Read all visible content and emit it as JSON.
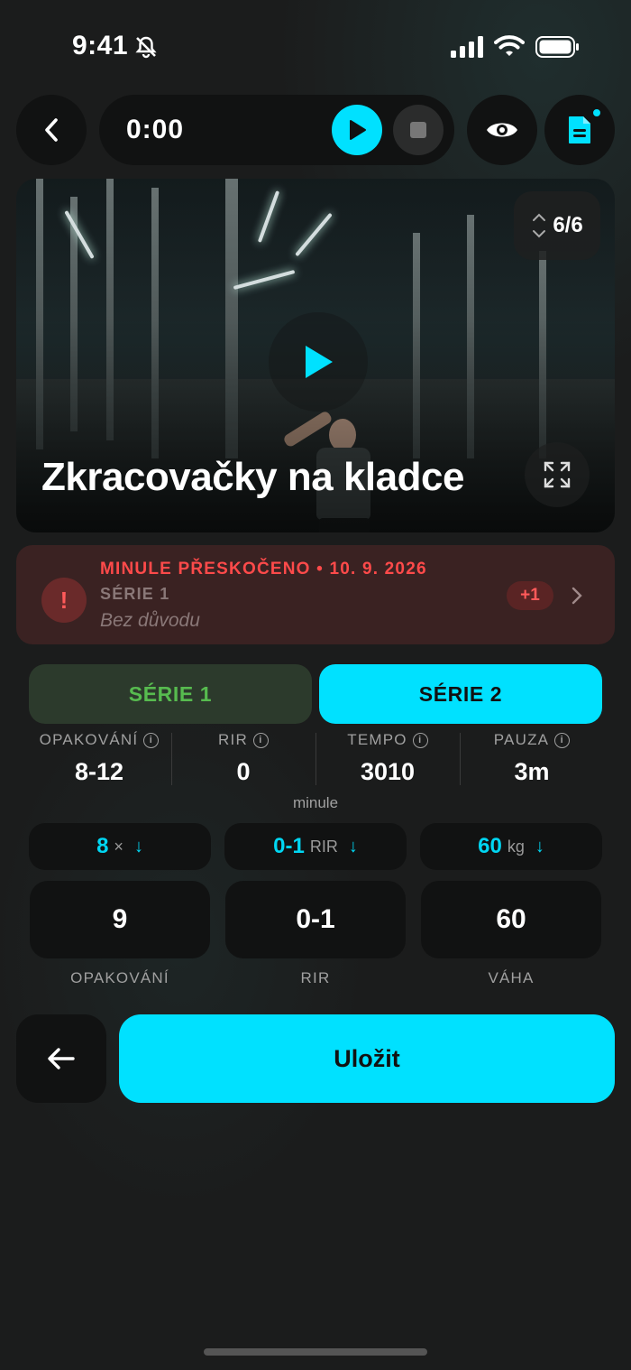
{
  "status_bar": {
    "time": "9:41",
    "icons": [
      "bell-slash-icon",
      "cellular-signal-icon",
      "wifi-icon",
      "battery-icon"
    ]
  },
  "toolbar": {
    "back_icon": "chevron-left-icon",
    "timer": "0:00",
    "play_icon": "play-icon",
    "stop_icon": "stop-icon",
    "view_icon": "eye-icon",
    "notes_icon": "document-icon"
  },
  "video": {
    "counter": "6/6",
    "title": "Zkracovačky na kladce",
    "play_icon": "play-icon",
    "expand_icon": "expand-icon"
  },
  "skipped_alert": {
    "title": "MINULE PŘESKOČENO • 10. 9. 2026",
    "series": "SÉRIE 1",
    "reason": "Bez důvodu",
    "badge": "+1"
  },
  "series_tabs": [
    {
      "label": "SÉRIE 1",
      "state": "done"
    },
    {
      "label": "SÉRIE 2",
      "state": "active"
    }
  ],
  "stats": [
    {
      "label": "OPAKOVÁNÍ",
      "value": "8-12"
    },
    {
      "label": "RIR",
      "value": "0"
    },
    {
      "label": "TEMPO",
      "value": "3010"
    },
    {
      "label": "PAUZA",
      "value": "3m"
    }
  ],
  "previous_label": "minule",
  "previous": [
    {
      "value": "8",
      "unit": "×",
      "arrow": "↓"
    },
    {
      "value": "0-1",
      "unit": "RIR",
      "arrow": "↓"
    },
    {
      "value": "60",
      "unit": "kg",
      "arrow": "↓"
    }
  ],
  "inputs": [
    {
      "value": "9",
      "label": "OPAKOVÁNÍ"
    },
    {
      "value": "0-1",
      "label": "RIR"
    },
    {
      "value": "60",
      "label": "VÁHA"
    }
  ],
  "actions": {
    "back_icon": "arrow-left-icon",
    "save_label": "Uložit"
  },
  "colors": {
    "accent": "#00e1ff",
    "background": "#1b1c1c",
    "alert": "#ff4a4a",
    "done_green": "#57bb4f"
  }
}
